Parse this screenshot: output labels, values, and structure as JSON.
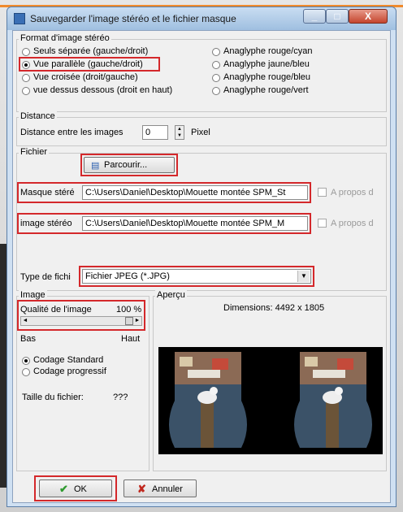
{
  "window": {
    "title": "Sauvegarder l'image stéréo et le fichier masque"
  },
  "format": {
    "title": "Format d'image stéréo",
    "options_left": [
      {
        "label": "Seuls séparée (gauche/droit)",
        "selected": false
      },
      {
        "label": "Vue parallèle (gauche/droit)",
        "selected": true
      },
      {
        "label": "Vue croisée (droit/gauche)",
        "selected": false
      },
      {
        "label": "vue dessus dessous (droit en haut)",
        "selected": false
      }
    ],
    "options_right": [
      {
        "label": "Anaglyphe rouge/cyan",
        "selected": false
      },
      {
        "label": "Anaglyphe jaune/bleu",
        "selected": false
      },
      {
        "label": "Anaglyphe rouge/bleu",
        "selected": false
      },
      {
        "label": "Anaglyphe rouge/vert",
        "selected": false
      }
    ]
  },
  "distance": {
    "title": "Distance",
    "label": "Distance entre les images",
    "value": "0",
    "unit": "Pixel"
  },
  "fichier": {
    "title": "Fichier",
    "browse_label": "Parcourir...",
    "mask_label": "Masque stéré",
    "mask_path": "C:\\Users\\Daniel\\Desktop\\Mouette montée SPM_St",
    "mask_about": "A propos d",
    "image_label": "image stéréo",
    "image_path": "C:\\Users\\Daniel\\Desktop\\Mouette montée SPM_M",
    "image_about": "A propos d",
    "type_label": "Type de fichi",
    "type_value": "Fichier JPEG (*.JPG)"
  },
  "image": {
    "title": "Image",
    "quality_label": "Qualité de l'image",
    "quality_value": "100 %",
    "quality_level": 1.0,
    "low": "Bas",
    "high": "Haut",
    "coding": [
      {
        "label": "Codage Standard",
        "selected": true
      },
      {
        "label": "Codage progressif",
        "selected": false
      }
    ],
    "size_label": "Taille du fichier:",
    "size_value": "???"
  },
  "apercu": {
    "title": "Aperçu",
    "dimensions": "Dimensions: 4492 x 1805"
  },
  "buttons": {
    "ok": "OK",
    "cancel": "Annuler"
  },
  "colors": {
    "highlight": "#d4282b",
    "ok_check": "#2f9a2f",
    "cancel_x": "#c0281e"
  }
}
